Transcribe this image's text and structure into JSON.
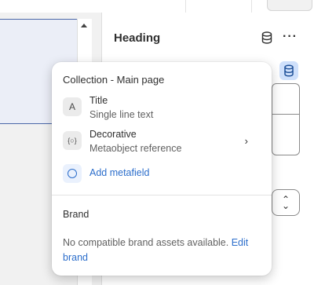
{
  "panel": {
    "heading": "Heading"
  },
  "popover": {
    "title": "Collection - Main page",
    "items": [
      {
        "icon": "text-type-icon",
        "icon_glyph": "A",
        "label": "Title",
        "sub": "Single line text",
        "has_chevron": false
      },
      {
        "icon": "metaobject-icon",
        "icon_glyph": "{○}",
        "label": "Decorative",
        "sub": "Metaobject reference",
        "has_chevron": true
      }
    ],
    "add_metafield": "Add metafield",
    "brand_title": "Brand",
    "brand_message": "No compatible brand assets available.",
    "brand_link": "Edit brand"
  },
  "colors": {
    "accent": "#2c6ecb",
    "accent_bg": "#cfe0fb",
    "text": "#303030",
    "subtext": "#616161"
  }
}
